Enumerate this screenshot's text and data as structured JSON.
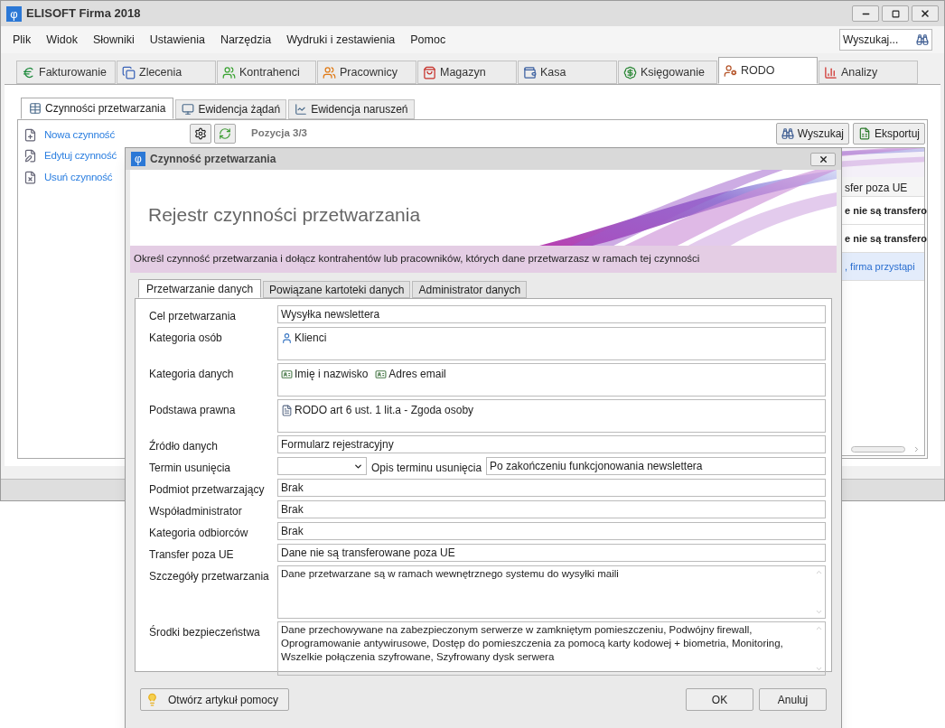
{
  "window": {
    "logo": "φ",
    "title": "ELISOFT Firma 2018"
  },
  "menu": [
    "Plik",
    "Widok",
    "Słowniki",
    "Ustawienia",
    "Narzędzia",
    "Wydruki i zestawienia",
    "Pomoc"
  ],
  "search": {
    "placeholder": "Wyszukaj..."
  },
  "module_tabs": [
    {
      "label": "Fakturowanie",
      "selected": false
    },
    {
      "label": "Zlecenia",
      "selected": false
    },
    {
      "label": "Kontrahenci",
      "selected": false
    },
    {
      "label": "Pracownicy",
      "selected": false
    },
    {
      "label": "Magazyn",
      "selected": false
    },
    {
      "label": "Kasa",
      "selected": false
    },
    {
      "label": "Księgowanie",
      "selected": false
    },
    {
      "label": "RODO",
      "selected": true
    },
    {
      "label": "Analizy",
      "selected": false
    }
  ],
  "sub_tabs": [
    {
      "label": "Czynności przetwarzania",
      "selected": true
    },
    {
      "label": "Ewidencja żądań",
      "selected": false
    },
    {
      "label": "Ewidencja naruszeń",
      "selected": false
    }
  ],
  "actions": [
    "Nowa czynność",
    "Edytuj czynność",
    "Usuń czynność"
  ],
  "toolbar": {
    "position": "Pozycja 3/3",
    "buttons": [
      "Wyszukaj",
      "Eksportuj"
    ]
  },
  "grid": {
    "column_header": "sfer poza UE",
    "rows": [
      {
        "text": "e nie są transfero",
        "selected": false
      },
      {
        "text": "e nie są transfero",
        "selected": false
      },
      {
        "text": ", firma przystąpi",
        "selected": true
      }
    ]
  },
  "dialog": {
    "logo": "φ",
    "title": "Czynność przetwarzania",
    "heading": "Rejestr czynności przetwarzania",
    "info": "Określ czynność przetwarzania i dołącz kontrahentów lub pracowników, których dane przetwarzasz w ramach tej czynności",
    "tabs": [
      {
        "label": "Przetwarzanie danych",
        "selected": true
      },
      {
        "label": "Powiązane kartoteki danych",
        "selected": false
      },
      {
        "label": "Administrator danych",
        "selected": false
      }
    ],
    "fields": [
      {
        "kind": "text",
        "label": "Cel przetwarzania",
        "value": "Wysyłka newslettera"
      },
      {
        "kind": "tags",
        "label": "Kategoria osób",
        "tags": [
          {
            "kind": "person",
            "text": "Klienci"
          }
        ]
      },
      {
        "kind": "tags",
        "label": "Kategoria danych",
        "tags": [
          {
            "kind": "card",
            "text": "Imię i nazwisko"
          },
          {
            "kind": "card",
            "text": "Adres email"
          }
        ]
      },
      {
        "kind": "tags",
        "label": "Podstawa prawna",
        "tags": [
          {
            "kind": "document",
            "text": "RODO art 6 ust. 1 lit.a - Zgoda osoby"
          }
        ]
      },
      {
        "kind": "text",
        "label": "Źródło danych",
        "value": "Formularz rejestracyjny"
      },
      {
        "kind": "combo_pair",
        "label": "Termin usunięcia",
        "second_label": "Opis terminu usunięcia",
        "second_value": "Po zakończeniu funkcjonowania newslettera"
      },
      {
        "kind": "text",
        "label": "Podmiot przetwarzający",
        "value": "Brak"
      },
      {
        "kind": "text",
        "label": "Współadministrator",
        "value": "Brak"
      },
      {
        "kind": "text",
        "label": "Kategoria odbiorców",
        "value": "Brak"
      },
      {
        "kind": "text",
        "label": "Transfer poza UE",
        "value": "Dane nie są transferowane poza UE"
      },
      {
        "kind": "memo",
        "label": "Szczegóły przetwarzania",
        "value": "Dane przetwarzane są w ramach wewnętrznego systemu do wysyłki maili"
      },
      {
        "kind": "memo",
        "label": "Środki bezpieczeństwa",
        "value": "Dane przechowywane na zabezpieczonym serwerze w zamkniętym pomieszczeniu, Podwójny firewall, Oprogramowanie antywirusowe, Dostęp do pomieszczenia za pomocą karty kodowej + biometria, Monitoring, Wszelkie połączenia szyfrowane, Szyfrowany dysk serwera"
      }
    ],
    "help_button": "Otwórz artykuł pomocy",
    "ok_button": "OK",
    "cancel_button": "Anuluj"
  }
}
